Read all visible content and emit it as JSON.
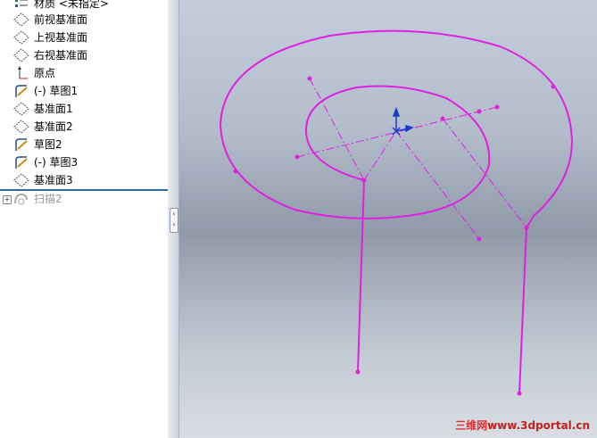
{
  "feature_tree": {
    "items": [
      {
        "label": "材质 <未指定>",
        "icon": "material-icon",
        "dim": false
      },
      {
        "label": "前视基准面",
        "icon": "plane-icon",
        "dim": false
      },
      {
        "label": "上视基准面",
        "icon": "plane-icon",
        "dim": false
      },
      {
        "label": "右视基准面",
        "icon": "plane-icon",
        "dim": false
      },
      {
        "label": "原点",
        "icon": "origin-icon",
        "dim": false
      },
      {
        "label": "(-) 草图1",
        "icon": "sketch-icon",
        "dim": false
      },
      {
        "label": "基准面1",
        "icon": "plane-icon",
        "dim": false
      },
      {
        "label": "基准面2",
        "icon": "plane-icon",
        "dim": false
      },
      {
        "label": "草图2",
        "icon": "sketch-icon",
        "dim": false
      },
      {
        "label": "(-) 草图3",
        "icon": "sketch-icon",
        "dim": false
      },
      {
        "label": "基准面3",
        "icon": "plane-icon",
        "dim": false
      },
      {
        "label": "扫描2",
        "icon": "sweep-icon",
        "dim": true
      }
    ]
  },
  "viewport": {
    "sketch_color": "#e020e0",
    "triad_color": "#1a3cc8"
  },
  "watermark": {
    "cn": "三维网",
    "url": "www.3dportal.cn"
  }
}
